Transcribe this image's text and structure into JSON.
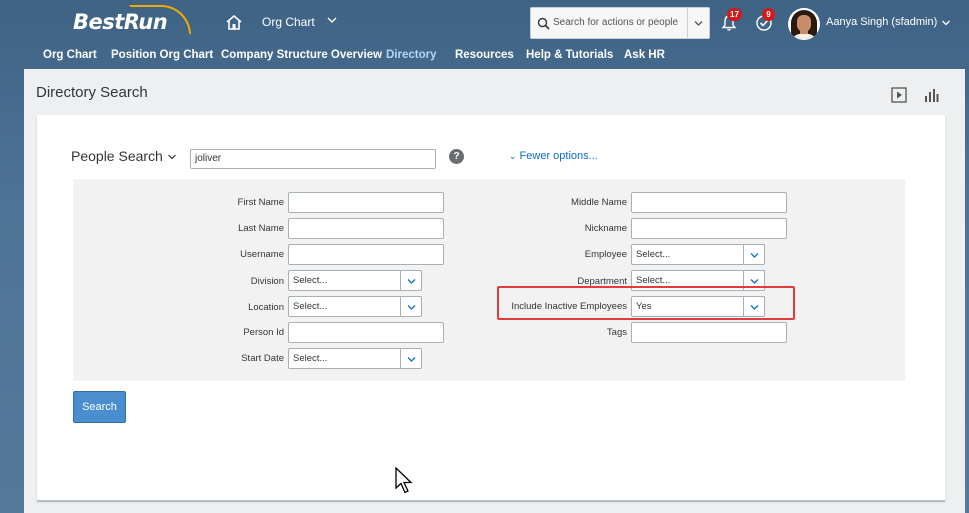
{
  "header": {
    "logo": "BestRun",
    "app_title": "Org Chart",
    "search_placeholder": "Search for actions or people",
    "notifications_count": "17",
    "todo_count": "9",
    "user_name": "Aanya Singh (sfadmin)"
  },
  "nav": {
    "items": [
      {
        "label": "Org Chart",
        "active": false
      },
      {
        "label": "Position Org Chart",
        "active": false
      },
      {
        "label": "Company Structure Overview",
        "active": false
      },
      {
        "label": "Directory",
        "active": true
      },
      {
        "label": "Resources",
        "active": false
      },
      {
        "label": "Help & Tutorials",
        "active": false
      },
      {
        "label": "Ask HR",
        "active": false
      }
    ]
  },
  "page": {
    "title": "Directory Search"
  },
  "search": {
    "mode_label": "People Search",
    "query": "joliver",
    "help": "?",
    "fewer_options": "Fewer options..."
  },
  "form": {
    "left": {
      "first_name": {
        "label": "First Name",
        "value": ""
      },
      "last_name": {
        "label": "Last Name",
        "value": ""
      },
      "username": {
        "label": "Username",
        "value": ""
      },
      "division": {
        "label": "Division",
        "value": "Select..."
      },
      "location": {
        "label": "Location",
        "value": "Select..."
      },
      "person_id": {
        "label": "Person Id",
        "value": ""
      },
      "start_date": {
        "label": "Start Date",
        "value": "Select..."
      }
    },
    "right": {
      "middle_name": {
        "label": "Middle Name",
        "value": ""
      },
      "nickname": {
        "label": "Nickname",
        "value": ""
      },
      "employee": {
        "label": "Employee",
        "value": "Select..."
      },
      "department": {
        "label": "Department",
        "value": "Select..."
      },
      "include_inactive": {
        "label": "Include Inactive Employees",
        "value": "Yes"
      },
      "tags": {
        "label": "Tags",
        "value": ""
      }
    }
  },
  "actions": {
    "search_label": "Search"
  },
  "colors": {
    "accent": "#0a6ed1",
    "button": "#4a8ed0",
    "highlight": "#e33b3b",
    "badge": "#d11a1a"
  }
}
